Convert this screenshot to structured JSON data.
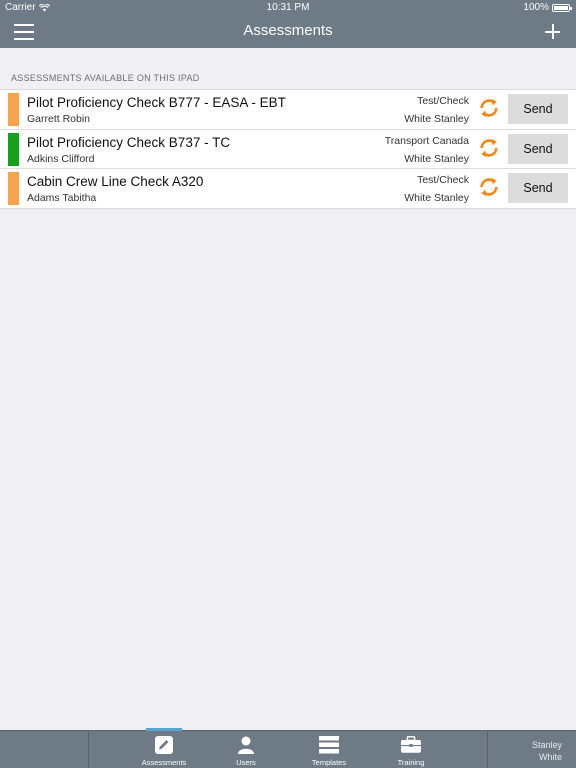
{
  "status": {
    "carrier": "Carrier",
    "time": "10:31 PM",
    "battery": "100%"
  },
  "header": {
    "title": "Assessments"
  },
  "section_title": "ASSESSMENTS AVAILABLE ON THIS IPAD",
  "assessments": [
    {
      "title": "Pilot Proficiency Check B777 - EASA - EBT",
      "trainee": "Garrett Robin",
      "type": "Test/Check",
      "assessor": "White Stanley",
      "color": "#f7a24c",
      "action": "Send"
    },
    {
      "title": "Pilot Proficiency Check B737 - TC",
      "trainee": "Adkins Clifford",
      "type": "Transport Canada",
      "assessor": "White Stanley",
      "color": "#17a11b",
      "action": "Send"
    },
    {
      "title": "Cabin Crew Line Check A320",
      "trainee": "Adams Tabitha",
      "type": "Test/Check",
      "assessor": "White Stanley",
      "color": "#f7a24c",
      "action": "Send"
    }
  ],
  "tabs": [
    {
      "label": "Assessments",
      "icon": "pencil-icon",
      "active": true
    },
    {
      "label": "Users",
      "icon": "user-icon",
      "active": false
    },
    {
      "label": "Templates",
      "icon": "templates-icon",
      "active": false
    },
    {
      "label": "Training",
      "icon": "briefcase-icon",
      "active": false
    }
  ],
  "current_user": {
    "first": "Stanley",
    "last": "White"
  },
  "colors": {
    "nav": "#6f7a87",
    "sync": "#f08a1c",
    "tab_active": "#5ba3d0"
  }
}
